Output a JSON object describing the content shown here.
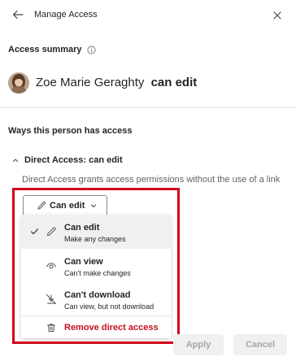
{
  "header": {
    "title": "Manage Access"
  },
  "summary": {
    "heading": "Access summary",
    "person_name": "Zoe Marie Geraghty",
    "person_permission": "can edit"
  },
  "ways": {
    "heading": "Ways this person has access",
    "direct_access_label": "Direct Access: can edit",
    "direct_access_description": "Direct Access grants access permissions without the use of a link"
  },
  "permission_dropdown": {
    "label": "Can edit"
  },
  "menu": {
    "items": [
      {
        "title": "Can edit",
        "subtitle": "Make any changes",
        "selected": true,
        "icon": "pencil-icon"
      },
      {
        "title": "Can view",
        "subtitle": "Can't make changes",
        "selected": false,
        "icon": "eye-icon"
      },
      {
        "title": "Can't download",
        "subtitle": "Can view, but not download",
        "selected": false,
        "icon": "no-download-icon"
      }
    ],
    "remove_label": "Remove direct access"
  },
  "footer": {
    "apply_label": "Apply",
    "cancel_label": "Cancel"
  },
  "colors": {
    "highlight": "#d0021b",
    "danger": "#c50f1f",
    "selected_bg": "#f0f0f0"
  }
}
